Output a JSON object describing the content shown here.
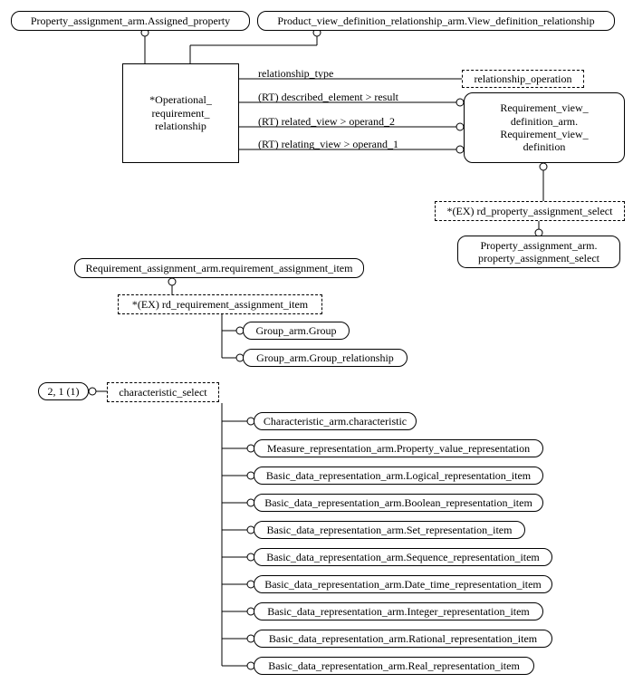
{
  "topLeftSuper": "Property_assignment_arm.Assigned_property",
  "topRightSuper": "Product_view_definition_relationship_arm.View_definition_relationship",
  "mainEntity": "*Operational_\nrequirement_\nrelationship",
  "attr1": "relationship_type",
  "attr1Target": "relationship_operation",
  "attr2": "(RT) described_element > result",
  "attr3": "(RT) related_view > operand_2",
  "attr4": "(RT) relating_view > operand_1",
  "reqViewDef": "Requirement_view_\ndefinition_arm.\nRequirement_view_\ndefinition",
  "exProp": "*(EX) rd_property_assignment_select",
  "propAssignSel": "Property_assignment_arm.\nproperty_assignment_select",
  "reqAssignItem": "Requirement_assignment_arm.requirement_assignment_item",
  "exReq": "*(EX) rd_requirement_assignment_item",
  "group": "Group_arm.Group",
  "groupRel": "Group_arm.Group_relationship",
  "pageRef": "2, 1 (1)",
  "charSelect": "characteristic_select",
  "cs": [
    "Characteristic_arm.characteristic",
    "Measure_representation_arm.Property_value_representation",
    "Basic_data_representation_arm.Logical_representation_item",
    "Basic_data_representation_arm.Boolean_representation_item",
    "Basic_data_representation_arm.Set_representation_item",
    "Basic_data_representation_arm.Sequence_representation_item",
    "Basic_data_representation_arm.Date_time_representation_item",
    "Basic_data_representation_arm.Integer_representation_item",
    "Basic_data_representation_arm.Rational_representation_item",
    "Basic_data_representation_arm.Real_representation_item"
  ]
}
